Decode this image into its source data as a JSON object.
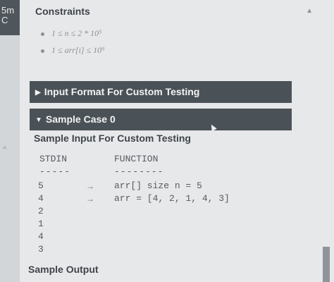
{
  "left": {
    "tab_label": "5m\nC",
    "chev": "^"
  },
  "constraints": {
    "title": "Constraints",
    "items": [
      "1 ≤ n ≤ 2 * 10⁵",
      "1 ≤ arr[i] ≤ 10⁹"
    ]
  },
  "bars": {
    "input_format": "Input Format For Custom Testing",
    "sample_case": "Sample Case 0"
  },
  "sample_input": {
    "title": "Sample Input For Custom Testing",
    "stdin_header": "STDIN",
    "stdin_dash": "-----",
    "function_header": "FUNCTION",
    "function_dash": "--------",
    "stdin_values": [
      "5",
      "4",
      "2",
      "1",
      "4",
      "3"
    ],
    "arrow": "→",
    "function_lines": [
      "arr[] size n = 5",
      "arr = [4, 2, 1, 4, 3]"
    ]
  },
  "sample_output": {
    "title": "Sample Output"
  }
}
